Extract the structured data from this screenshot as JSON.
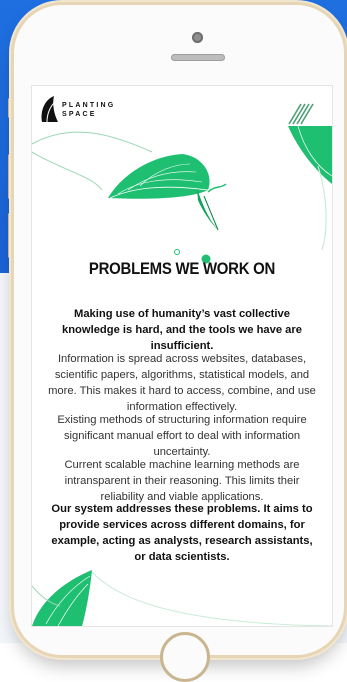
{
  "brand": {
    "line1": "PLANTING",
    "line2": "SPACE"
  },
  "main": {
    "heading": "PROBLEMS WE WORK ON",
    "intro": "Making use of humanity’s vast collective knowledge is hard, and the tools we have are insufficient.",
    "p1": "Information is spread across websites, databases, scientific papers, algorithms, statistical models, and more. This makes it hard to access, combine, and use information effectively.",
    "p2": "Existing methods of structuring information require significant manual effort to deal with information uncertainty.",
    "p3": "Current scalable machine learning methods are intransparent in their reasoning. This limits their reliability and viable applications.",
    "closing": "Our system addresses these problems. It aims to provide services across different domains, for example, acting as analysts, research assistants, or data scientists."
  },
  "colors": {
    "accent": "#1fbf72",
    "background": "#1f6fe0"
  },
  "icons": {
    "logo": "planting-space-logo",
    "stripes": "diagonal-stripes-icon"
  }
}
